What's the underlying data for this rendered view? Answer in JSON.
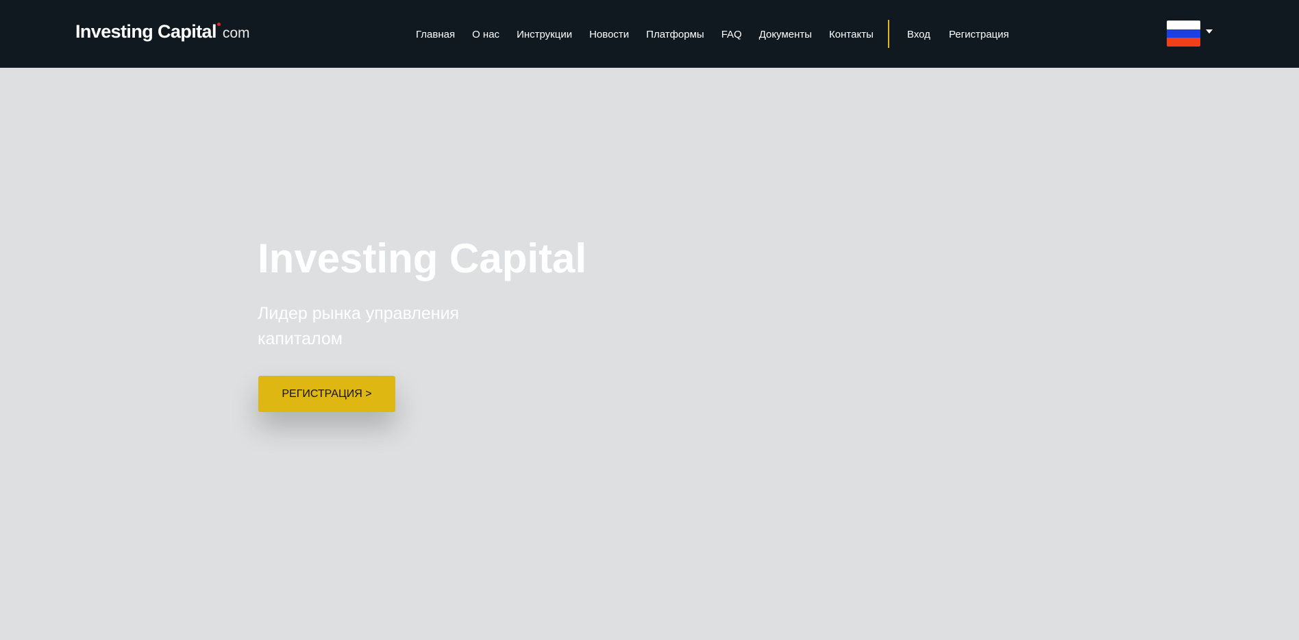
{
  "header": {
    "logo": {
      "main": "Investing Capital",
      "tld": "com"
    },
    "nav": [
      {
        "label": "Главная"
      },
      {
        "label": "О нас"
      },
      {
        "label": "Инструкции"
      },
      {
        "label": "Новости"
      },
      {
        "label": "Платформы"
      },
      {
        "label": "FAQ"
      },
      {
        "label": "Документы"
      },
      {
        "label": "Контакты"
      }
    ],
    "auth": {
      "login": "Вход",
      "register": "Регистрация"
    },
    "language": {
      "icon": "russia-flag-icon",
      "colors": [
        "#ffffff",
        "#1b3fe0",
        "#f0401a"
      ]
    }
  },
  "hero": {
    "title": "Investing Capital",
    "subtitle": "Лидер рынка управления капиталом",
    "button": "РЕГИСТРАЦИЯ >"
  },
  "colors": {
    "header_bg": "#111920",
    "page_bg": "#dedfe1",
    "accent": "#dfb712",
    "logo_dot": "#e2242b"
  }
}
